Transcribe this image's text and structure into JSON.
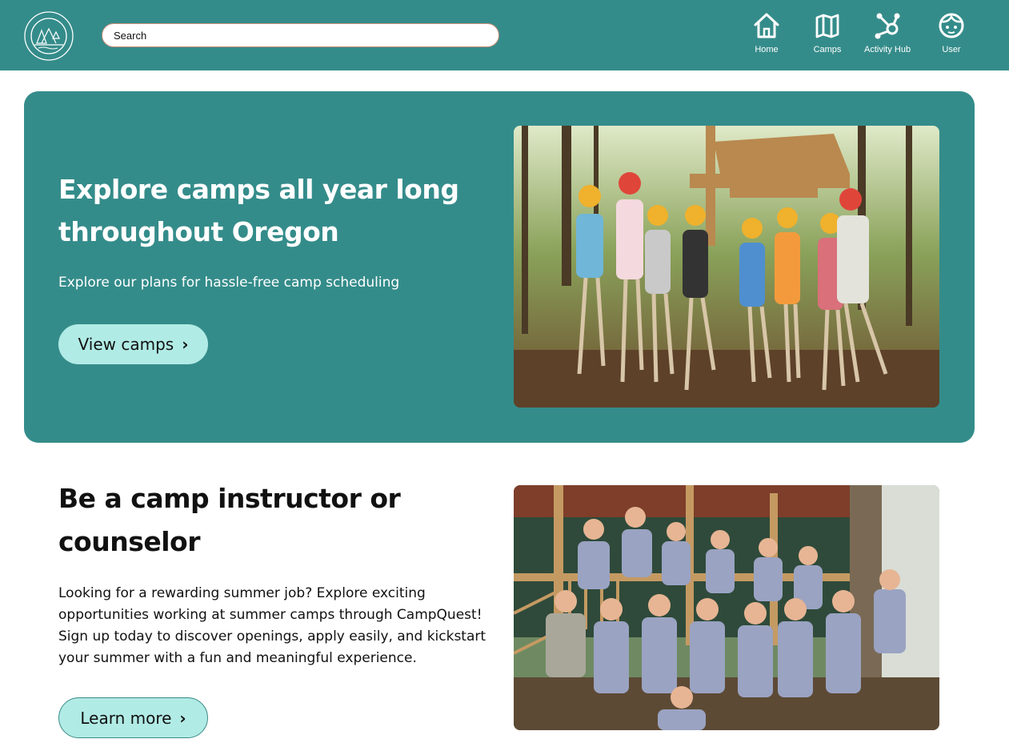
{
  "header": {
    "logo_text": "CAMPQUEST",
    "search": {
      "placeholder": "Search",
      "value": ""
    },
    "nav": [
      {
        "label": "Home",
        "icon": "home-icon"
      },
      {
        "label": "Camps",
        "icon": "map-icon"
      },
      {
        "label": "Activity Hub",
        "icon": "hub-icon"
      },
      {
        "label": "User",
        "icon": "user-icon"
      }
    ]
  },
  "hero": {
    "title": "Explore camps all year long throughout Oregon",
    "subtitle": "Explore our plans for hassle-free camp scheduling",
    "button_label": "View camps",
    "button_icon": "chevron-right-icon"
  },
  "instructor": {
    "title": "Be a camp instructor or counselor",
    "body": "Looking for a rewarding summer job? Explore exciting opportunities working at summer camps through CampQuest! Sign up today to discover openings, apply easily, and kickstart your summer with a fun and meaningful experience.",
    "button_label": "Learn more",
    "button_icon": "chevron-right-icon"
  },
  "colors": {
    "brand_teal": "#348c8a",
    "button_mint": "#b1ebe5",
    "search_border": "#c98d7a"
  }
}
